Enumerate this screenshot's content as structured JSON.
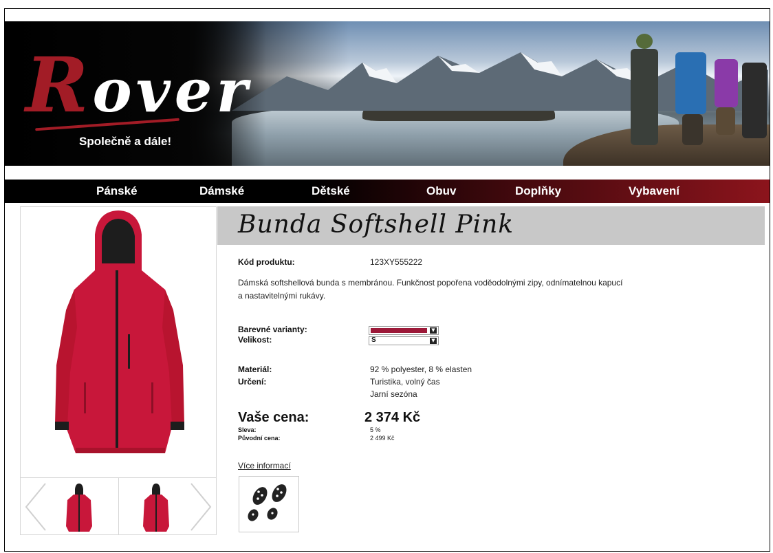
{
  "brand": {
    "logo_text": "Rover",
    "tagline": "Společně a dále!"
  },
  "nav": {
    "items": [
      {
        "label": "Pánské"
      },
      {
        "label": "Dámské"
      },
      {
        "label": "Dětské"
      },
      {
        "label": "Obuv"
      },
      {
        "label": "Doplňky"
      },
      {
        "label": "Vybavení"
      }
    ]
  },
  "product": {
    "title": "Bunda Softshell Pink",
    "code_label": "Kód produktu:",
    "code_value": "123XY555222",
    "description": "Dámská softshellová bunda s membránou. Funkčnost popořena voděodolnými zipy, odnímatelnou kapucí a nastavitelnými rukávy.",
    "color_label": "Barevné varianty:",
    "color_value": "#9c1838",
    "size_label": "Velikost:",
    "size_value": "S",
    "material_label": "Materiál:",
    "material_value": "92 % polyester, 8 % elasten",
    "purpose_label": "Určení:",
    "purpose_value_1": "Turistika, volný čas",
    "purpose_value_2": "Jarní sezóna",
    "price_label": "Vaše cena:",
    "price_value": "2 374 Kč",
    "discount_label": "Sleva:",
    "discount_value": "5 %",
    "original_price_label": "Původní cena:",
    "original_price_value": "2 499 Kč",
    "more_info_link": "Více informací"
  },
  "colors": {
    "brand_red": "#a21c26",
    "jacket_red": "#c8173a",
    "title_bar": "#c8c8c8"
  }
}
